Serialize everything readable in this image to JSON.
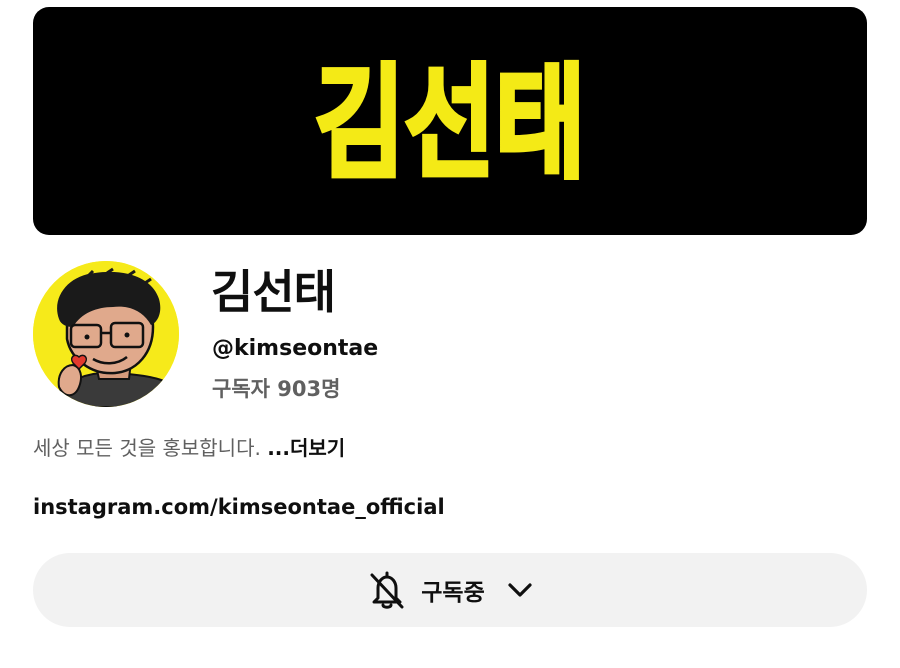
{
  "banner": {
    "text": "김선태",
    "text_color": "#f4ea16",
    "background": "#000000"
  },
  "avatar": {
    "background": "#f6ea1a",
    "icon": "caricature-avatar"
  },
  "channel": {
    "name": "김선태",
    "handle": "@kimseontae",
    "subscribers": "구독자 903명"
  },
  "description": {
    "text": "세상 모든 것을 홍보합니다. ",
    "more_label": "...더보기"
  },
  "link": {
    "text": "instagram.com/kimseontae_official"
  },
  "subscribe_button": {
    "label": "구독중",
    "icons": [
      "bell-off-icon",
      "chevron-down-icon"
    ],
    "background": "#f2f2f2"
  }
}
